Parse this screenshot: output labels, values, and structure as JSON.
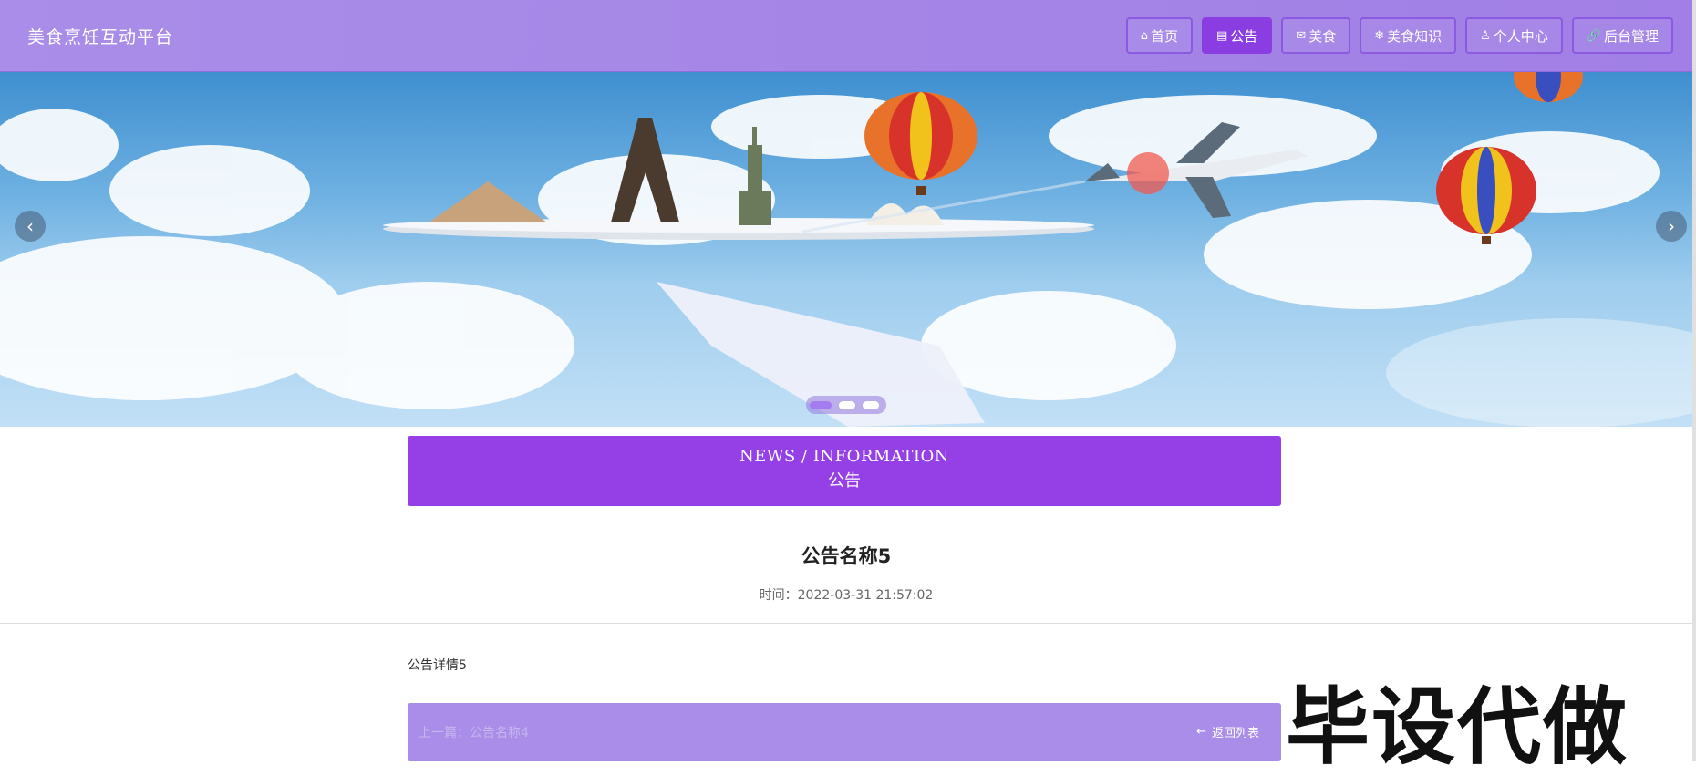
{
  "header": {
    "brand": "美食烹饪互动平台",
    "nav": [
      {
        "icon": "home-icon",
        "glyph": "⌂",
        "label": "首页",
        "active": false
      },
      {
        "icon": "notice-icon",
        "glyph": "▤",
        "label": "公告",
        "active": true
      },
      {
        "icon": "mail-icon",
        "glyph": "✉",
        "label": "美食",
        "active": false
      },
      {
        "icon": "snowflake-icon",
        "glyph": "❄",
        "label": "美食知识",
        "active": false
      },
      {
        "icon": "user-icon",
        "glyph": "♙",
        "label": "个人中心",
        "active": false
      },
      {
        "icon": "link-icon",
        "glyph": "🔗",
        "label": "后台管理",
        "active": false
      }
    ]
  },
  "banner": {
    "prev_arrow": "‹",
    "next_arrow": "›",
    "slide_count": 3,
    "current_slide": 1
  },
  "news_header": {
    "english": "NEWS / INFORMATION",
    "chinese": "公告"
  },
  "article": {
    "title": "公告名称5",
    "time_label": "时间：",
    "time_value": "2022-03-31 21:57:02",
    "body": "公告详情5"
  },
  "footer_bar": {
    "prev_link": "上一篇：公告名称4",
    "back_label": "返回列表",
    "back_icon": "←"
  },
  "watermark": "毕设代做",
  "colors": {
    "header_bg": "#a98de8",
    "active_nav": "#8a3de0",
    "news_bg": "#9440e6"
  }
}
